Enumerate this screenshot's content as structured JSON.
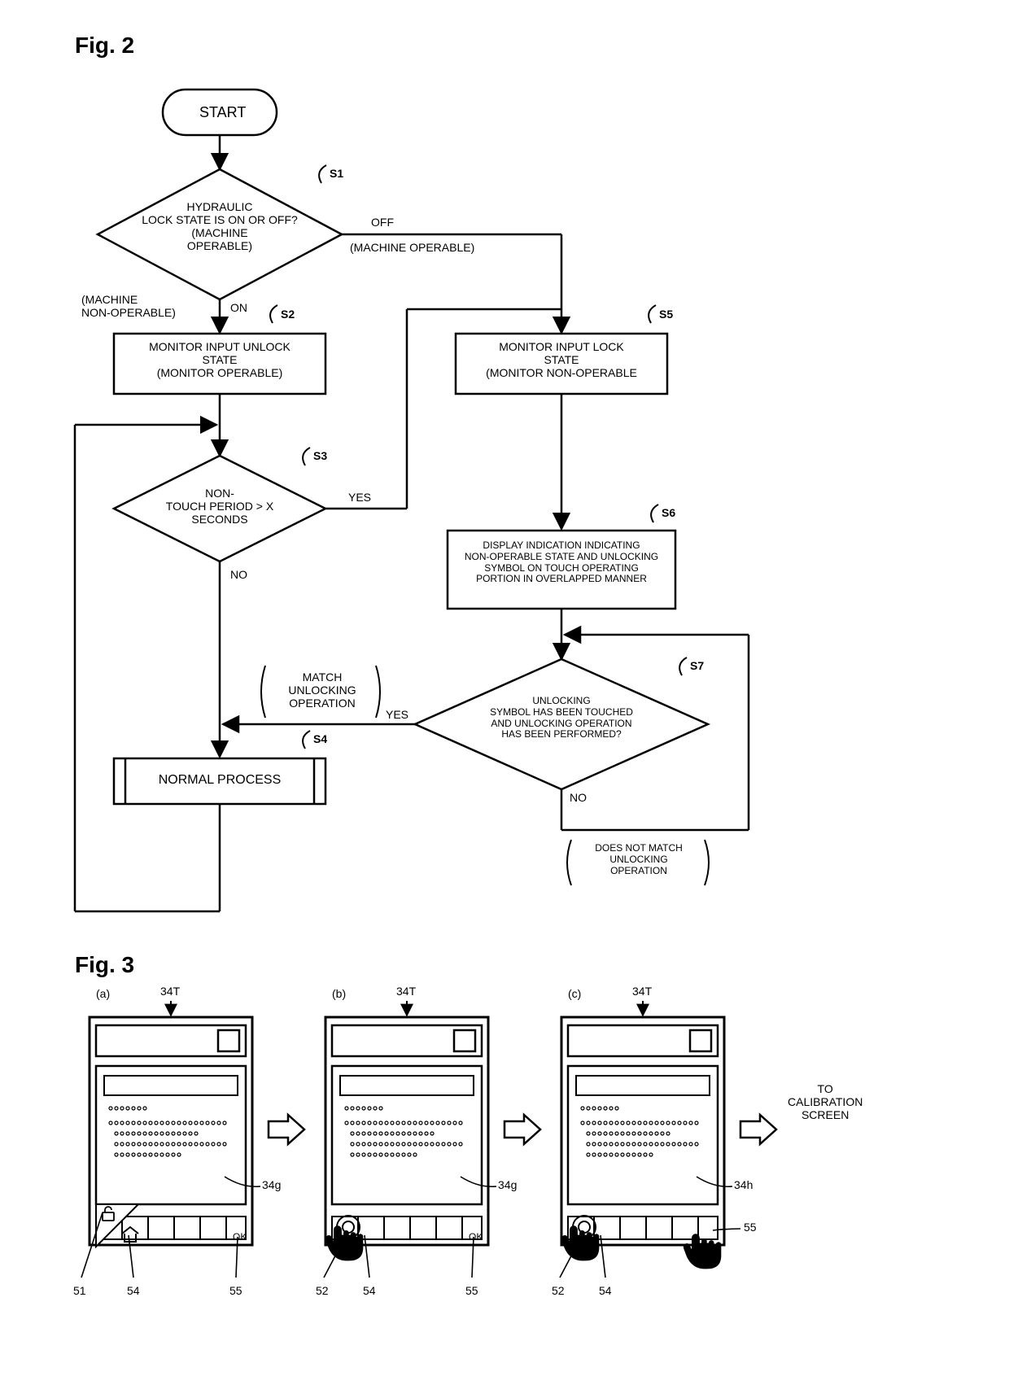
{
  "fig2": {
    "label": "Fig. 2",
    "start": "START",
    "s1": {
      "tag": "S1",
      "text1": "HYDRAULIC",
      "text2": "LOCK STATE IS ON OR OFF?",
      "text3": "(MACHINE",
      "text4": "OPERABLE)",
      "off": "OFF",
      "off_note": "(MACHINE OPERABLE)",
      "on": "ON",
      "on_note": "(MACHINE\nNON-OPERABLE)"
    },
    "s2": {
      "tag": "S2",
      "text": "MONITOR INPUT UNLOCK\nSTATE\n(MONITOR OPERABLE)"
    },
    "s3": {
      "tag": "S3",
      "text1": "NON-",
      "text2": "TOUCH  PERIOD > X",
      "text3": "SECONDS",
      "yes": "YES",
      "no": "NO"
    },
    "s4": {
      "tag": "S4",
      "text": "NORMAL PROCESS"
    },
    "s5": {
      "tag": "S5",
      "text": "MONITOR INPUT LOCK\nSTATE\n(MONITOR NON-OPERABLE"
    },
    "s6": {
      "tag": "S6",
      "text": "DISPLAY INDICATION INDICATING\nNON-OPERABLE STATE AND UNLOCKING\nSYMBOL ON TOUCH OPERATING\nPORTION IN OVERLAPPED MANNER"
    },
    "s7": {
      "tag": "S7",
      "text1": "UNLOCKING",
      "text2": "SYMBOL HAS BEEN TOUCHED",
      "text3": "AND UNLOCKING OPERATION",
      "text4": "HAS BEEN PERFORMED?",
      "yes": "YES",
      "no": "NO",
      "yes_note": "MATCH\nUNLOCKING\nOPERATION",
      "no_note": "DOES NOT MATCH\nUNLOCKING\nOPERATION"
    }
  },
  "fig3": {
    "label": "Fig. 3",
    "panels": {
      "a": "(a)",
      "b": "(b)",
      "c": "(c)"
    },
    "ref_34T": "34T",
    "ref_34g": "34g",
    "ref_34h": "34h",
    "ref_51": "51",
    "ref_52": "52",
    "ref_54": "54",
    "ref_55": "55",
    "ok": "OK",
    "to_cal": "TO\nCALIBRATION\nSCREEN"
  }
}
